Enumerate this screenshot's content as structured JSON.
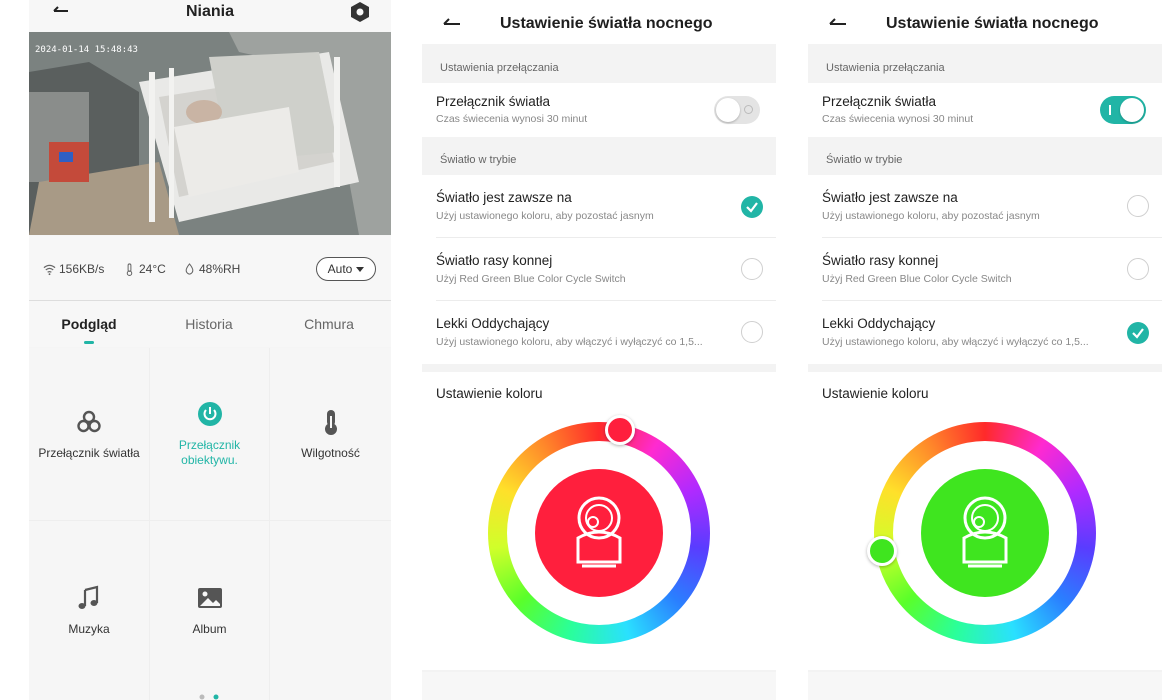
{
  "screen1": {
    "title": "Niania",
    "video_timestamp": "2024-01-14 15:48:43",
    "stats": {
      "network": "156KB/s",
      "temperature": "24°C",
      "humidity": "48%RH"
    },
    "auto_mode": "Auto",
    "tabs": [
      {
        "label": "Podgląd",
        "active": true
      },
      {
        "label": "Historia",
        "active": false
      },
      {
        "label": "Chmura",
        "active": false
      }
    ],
    "grid": [
      {
        "label": "Przełącznik światła",
        "icon": "light-switch-icon"
      },
      {
        "label": "Przełącznik obiektywu.",
        "icon": "power-icon",
        "highlighted": true
      },
      {
        "label": "Wilgotność",
        "icon": "thermometer-icon"
      },
      {
        "label": "Muzyka",
        "icon": "music-note-icon"
      },
      {
        "label": "Album",
        "icon": "image-icon"
      }
    ],
    "accent_color": "#21b5a6"
  },
  "screen2": {
    "title": "Ustawienie światła nocnego",
    "switch_section": "Ustawienia przełączania",
    "switch_title": "Przełącznik światła",
    "switch_sub": "Czas świecenia wynosi 30 minut",
    "switch_on": false,
    "mode_section": "Światło w trybie",
    "modes": [
      {
        "title": "Światło jest zawsze na",
        "sub": "Użyj ustawionego koloru, aby pozostać jasnym",
        "selected": true
      },
      {
        "title": "Światło rasy konnej",
        "sub": "Użyj Red Green Blue Color Cycle Switch",
        "selected": false
      },
      {
        "title": "Lekki Oddychający",
        "sub": "Użyj ustawionego koloru, aby włączyć i wyłączyć co 1,5...",
        "selected": false
      }
    ],
    "color_title": "Ustawienie koloru",
    "selected_color": "#ff1f3d"
  },
  "screen3": {
    "title": "Ustawienie światła nocnego",
    "switch_section": "Ustawienia przełączania",
    "switch_title": "Przełącznik światła",
    "switch_sub": "Czas świecenia wynosi 30 minut",
    "switch_on": true,
    "mode_section": "Światło w trybie",
    "modes": [
      {
        "title": "Światło jest zawsze na",
        "sub": "Użyj ustawionego koloru, aby pozostać jasnym",
        "selected": false
      },
      {
        "title": "Światło rasy konnej",
        "sub": "Użyj Red Green Blue Color Cycle Switch",
        "selected": false
      },
      {
        "title": "Lekki Oddychający",
        "sub": "Użyj ustawionego koloru, aby włączyć i wyłączyć co 1,5...",
        "selected": true
      }
    ],
    "color_title": "Ustawienie koloru",
    "selected_color": "#3fe51f"
  }
}
